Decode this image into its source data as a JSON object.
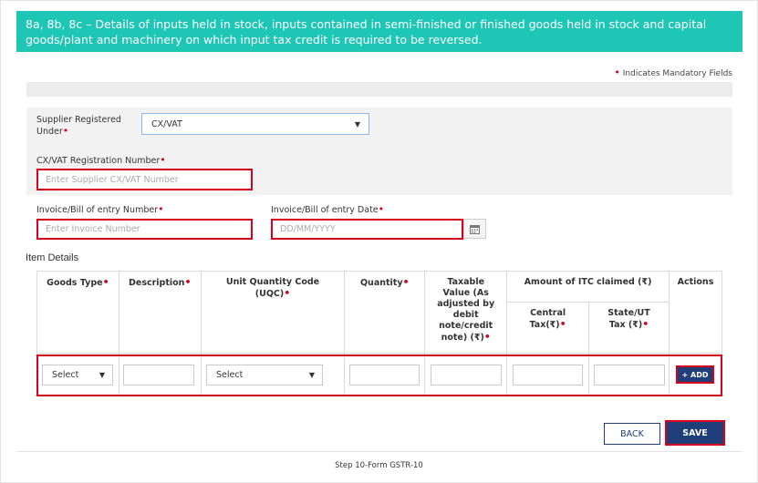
{
  "header": {
    "title": "8a, 8b, 8c – Details of inputs held in stock, inputs contained in semi-finished or finished goods held in stock and capital goods/plant and machinery on which input tax credit is required to be reversed."
  },
  "mandatory_note": "Indicates Mandatory Fields",
  "supplier": {
    "label": "Supplier Registered Under",
    "value": "CX/VAT"
  },
  "registration": {
    "label": "CX/VAT Registration Number",
    "placeholder": "Enter Supplier CX/VAT Number"
  },
  "invoice_number": {
    "label": "Invoice/Bill of entry Number",
    "placeholder": "Enter Invoice Number"
  },
  "invoice_date": {
    "label": "Invoice/Bill of entry Date",
    "placeholder": "DD/MM/YYYY",
    "icon": "calendar-icon"
  },
  "item_details": {
    "title": "Item Details",
    "columns": {
      "goods_type": "Goods Type",
      "description": "Description",
      "uqc": "Unit Quantity Code (UQC)",
      "quantity": "Quantity",
      "taxable_value": "Taxable Value (As adjusted by debit note/credit note) (₹)",
      "itc_group": "Amount of ITC claimed (₹)",
      "central_tax": "Central Tax(₹)",
      "state_tax": "State/UT Tax (₹)",
      "actions": "Actions"
    },
    "row": {
      "goods_type_value": "Select",
      "uqc_value": "Select",
      "add_label": "+ ADD"
    }
  },
  "buttons": {
    "back": "BACK",
    "save": "SAVE"
  },
  "caption": "Step 10-Form GSTR-10",
  "colors": {
    "header_bg": "#1ec6b6",
    "primary": "#1f3e7a",
    "highlight": "#d9001b"
  }
}
